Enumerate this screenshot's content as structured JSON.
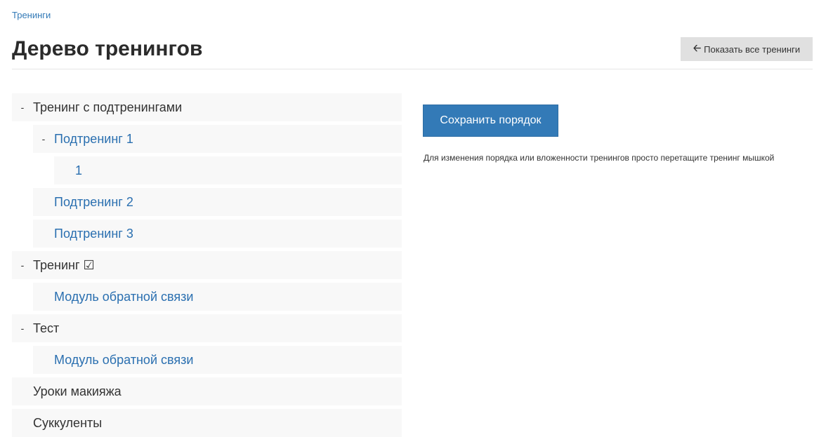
{
  "breadcrumb": {
    "label": "Тренинги"
  },
  "page": {
    "title": "Дерево тренингов"
  },
  "header": {
    "show_all_label": "Показать все тренинги",
    "show_all_icon": "arrow-left-icon"
  },
  "tree": {
    "nodes": [
      {
        "label": "Тренинг с подтренингами",
        "toggle": "-"
      },
      {
        "label": "Подтренинг 1",
        "toggle": "-"
      },
      {
        "label": "1"
      },
      {
        "label": "Подтренинг 2"
      },
      {
        "label": "Подтренинг 3"
      },
      {
        "label": "Тренинг ☑",
        "toggle": "-"
      },
      {
        "label": "Модуль обратной связи"
      },
      {
        "label": "Тест",
        "toggle": "-"
      },
      {
        "label": "Модуль обратной связи"
      },
      {
        "label": "Уроки макияжа"
      },
      {
        "label": "Суккуленты"
      }
    ]
  },
  "actions": {
    "save_label": "Сохранить порядок",
    "hint": "Для изменения порядка или вложенности тренингов просто перетащите тренинг мышкой"
  },
  "colors": {
    "primary": "#337ab7",
    "link": "#2a6fb0",
    "row_bg": "#f8f8f8",
    "secondary_btn": "#e0e0e0"
  }
}
